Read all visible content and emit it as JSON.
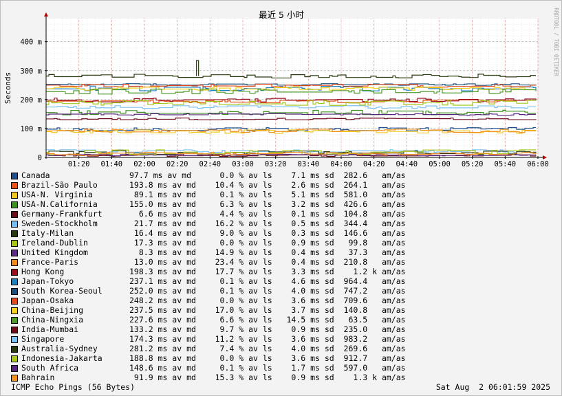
{
  "watermark": "RRDTOOL / TOBI OETIKER",
  "footer": {
    "left": "ICMP Echo Pings (56 Bytes)",
    "right": "Sat Aug  2 06:01:59 2025"
  },
  "chart_data": {
    "type": "line",
    "title": "最近 5 小时",
    "ylabel": "Seconds",
    "ylim": [
      0,
      0.48
    ],
    "yticks": [
      {
        "value": 0,
        "label": "0"
      },
      {
        "value": 0.1,
        "label": "100 m"
      },
      {
        "value": 0.2,
        "label": "200 m"
      },
      {
        "value": 0.3,
        "label": "300 m"
      },
      {
        "value": 0.4,
        "label": "400 m"
      }
    ],
    "xlim": [
      "01:00",
      "06:00"
    ],
    "xticks": [
      "01:20",
      "01:40",
      "02:00",
      "02:20",
      "02:40",
      "03:00",
      "03:20",
      "03:40",
      "04:00",
      "04:20",
      "04:40",
      "05:00",
      "05:20",
      "05:40",
      "06:00"
    ],
    "grid": true,
    "series": [
      {
        "name": "Canada",
        "color": "#1f4e8c",
        "avg": 0.0977,
        "stats": "97.7 ms av md      0.0 % av ls    7.1 ms sd  282.6   am/as"
      },
      {
        "name": "Brazil-São Paulo",
        "color": "#e8531b",
        "avg": 0.1938,
        "stats": "193.8 ms av md    10.4 % av ls    2.6 ms sd  264.1   am/as"
      },
      {
        "name": "USA-N. Virginia",
        "color": "#f0c81e",
        "avg": 0.0891,
        "stats": " 89.1 ms av md     0.1 % av ls    5.1 ms sd  581.0   am/as"
      },
      {
        "name": "USA-N.California",
        "color": "#3d8f1f",
        "avg": 0.155,
        "stats": "155.0 ms av md     6.3 % av ls    3.2 ms sd  426.6   am/as"
      },
      {
        "name": "Germany-Frankfurt",
        "color": "#6a0f18",
        "avg": 0.0066,
        "stats": "  6.6 ms av md     4.4 % av ls    0.1 ms sd  104.8   am/as"
      },
      {
        "name": "Sweden-Stockholm",
        "color": "#79bdf0",
        "avg": 0.0217,
        "stats": " 21.7 ms av md    16.2 % av ls    0.5 ms sd  344.4   am/as"
      },
      {
        "name": "Italy-Milan",
        "color": "#2c3a12",
        "avg": 0.0164,
        "stats": " 16.4 ms av md     9.0 % av ls    0.3 ms sd  146.6   am/as"
      },
      {
        "name": "Ireland-Dublin",
        "color": "#a8c414",
        "avg": 0.0173,
        "stats": " 17.3 ms av md     0.0 % av ls    0.9 ms sd   99.8   am/as"
      },
      {
        "name": "United Kingdom",
        "color": "#5b2a86",
        "avg": 0.0083,
        "stats": "  8.3 ms av md    14.9 % av ls    0.4 ms sd   37.3   am/as"
      },
      {
        "name": "France-Paris",
        "color": "#f08a1e",
        "avg": 0.013,
        "stats": " 13.0 ms av md    23.4 % av ls    0.4 ms sd  210.8   am/as"
      },
      {
        "name": "Hong Kong",
        "color": "#9a1020",
        "avg": 0.1983,
        "stats": "198.3 ms av md    17.7 % av ls    3.3 ms sd    1.2 k am/as"
      },
      {
        "name": "Japan-Tokyo",
        "color": "#1c7fc0",
        "avg": 0.2371,
        "stats": "237.1 ms av md     0.1 % av ls    4.6 ms sd  964.4   am/as"
      },
      {
        "name": "South Korea-Seoul",
        "color": "#1b4f7a",
        "avg": 0.252,
        "stats": "252.0 ms av md     0.1 % av ls    4.0 ms sd  747.2   am/as"
      },
      {
        "name": "Japan-Osaka",
        "color": "#e04a1c",
        "avg": 0.2482,
        "stats": "248.2 ms av md     0.0 % av ls    3.6 ms sd  709.6   am/as"
      },
      {
        "name": "China-Beijing",
        "color": "#f5d21c",
        "avg": 0.2375,
        "stats": "237.5 ms av md    17.0 % av ls    3.7 ms sd  140.8   am/as"
      },
      {
        "name": "China-Ningxia",
        "color": "#4e9a2a",
        "avg": 0.2276,
        "stats": "227.6 ms av md     6.6 % av ls   14.5 ms sd   63.5   am/as"
      },
      {
        "name": "India-Mumbai",
        "color": "#6e0b1a",
        "avg": 0.1332,
        "stats": "133.2 ms av md     9.7 % av ls    0.9 ms sd  235.0   am/as"
      },
      {
        "name": "Singapore",
        "color": "#7cc2f2",
        "avg": 0.1743,
        "stats": "174.3 ms av md    11.2 % av ls    3.6 ms sd  983.2   am/as"
      },
      {
        "name": "Australia-Sydney",
        "color": "#2b3b10",
        "avg": 0.2812,
        "stats": "281.2 ms av md     7.4 % av ls    4.0 ms sd  269.6   am/as"
      },
      {
        "name": "Indonesia-Jakarta",
        "color": "#a5c61a",
        "avg": 0.1888,
        "stats": "188.8 ms av md     0.0 % av ls    3.6 ms sd  912.7   am/as"
      },
      {
        "name": "South Africa",
        "color": "#55287e",
        "avg": 0.1486,
        "stats": "148.6 ms av md     0.1 % av ls    1.7 ms sd  597.0   am/as"
      },
      {
        "name": "Bahrain",
        "color": "#f0901e",
        "avg": 0.0919,
        "stats": " 91.9 ms av md    15.3 % av ls    0.9 ms sd    1.3 k am/as"
      }
    ]
  }
}
